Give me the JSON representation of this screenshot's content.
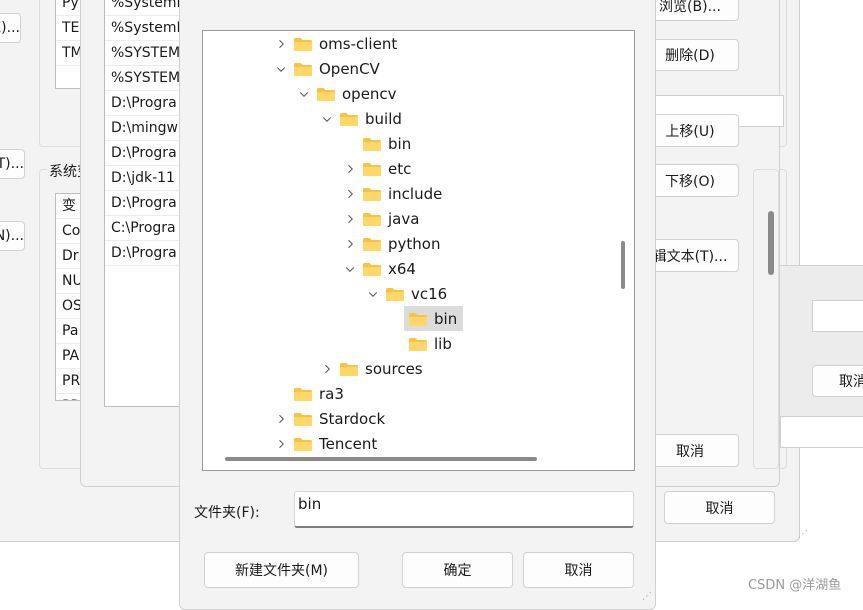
{
  "back_window": {
    "buttons": [
      "(E)...",
      "(T)...",
      "N)...",
      "取消"
    ],
    "user_vars_partial": [
      "Py",
      "TE",
      "TM"
    ],
    "system_vars_label": "系统变",
    "system_vars_partial": [
      "变",
      "Co",
      "Dr",
      "NU",
      "OS",
      "Pa",
      "PA",
      "PR",
      "PR"
    ]
  },
  "edit_env_window": {
    "paths": [
      "%SystemR",
      "%SystemR",
      "%SYSTEMR",
      "%SYSTEMR",
      "D:\\Progra",
      "D:\\mingw",
      "D:\\Progra",
      "D:\\jdk-11",
      "D:\\Progra",
      "C:\\Progra",
      "D:\\Progra"
    ],
    "buttons": {
      "browse": "浏览(B)...",
      "delete": "删除(D)",
      "move_up": "上移(U)",
      "move_down": "下移(O)",
      "edit_text": "辑文本(T)...",
      "cancel_inner": "取消",
      "cancel": "取消"
    }
  },
  "right_panel": {
    "cancel": "取消"
  },
  "folder_dialog": {
    "tree": [
      {
        "label": "oms-client",
        "depth": 0,
        "expander": "collapsed",
        "selected": false
      },
      {
        "label": "OpenCV",
        "depth": 0,
        "expander": "expanded",
        "selected": false
      },
      {
        "label": "opencv",
        "depth": 1,
        "expander": "expanded",
        "selected": false
      },
      {
        "label": "build",
        "depth": 2,
        "expander": "expanded",
        "selected": false
      },
      {
        "label": "bin",
        "depth": 3,
        "expander": "none",
        "selected": false
      },
      {
        "label": "etc",
        "depth": 3,
        "expander": "collapsed",
        "selected": false
      },
      {
        "label": "include",
        "depth": 3,
        "expander": "collapsed",
        "selected": false
      },
      {
        "label": "java",
        "depth": 3,
        "expander": "collapsed",
        "selected": false
      },
      {
        "label": "python",
        "depth": 3,
        "expander": "collapsed",
        "selected": false
      },
      {
        "label": "x64",
        "depth": 3,
        "expander": "expanded",
        "selected": false
      },
      {
        "label": "vc16",
        "depth": 4,
        "expander": "expanded",
        "selected": false
      },
      {
        "label": "bin",
        "depth": 5,
        "expander": "none",
        "selected": true
      },
      {
        "label": "lib",
        "depth": 5,
        "expander": "none",
        "selected": false
      },
      {
        "label": "sources",
        "depth": 2,
        "expander": "collapsed",
        "selected": false
      },
      {
        "label": "ra3",
        "depth": 0,
        "expander": "none",
        "selected": false
      },
      {
        "label": "Stardock",
        "depth": 0,
        "expander": "collapsed",
        "selected": false
      },
      {
        "label": "Tencent",
        "depth": 0,
        "expander": "collapsed",
        "selected": false
      }
    ],
    "folder_label": "文件夹(F):",
    "folder_value": "bin",
    "buttons": {
      "new_folder": "新建文件夹(M)",
      "ok": "确定",
      "cancel": "取消"
    }
  },
  "watermark": "CSDN @洋湖鱼"
}
